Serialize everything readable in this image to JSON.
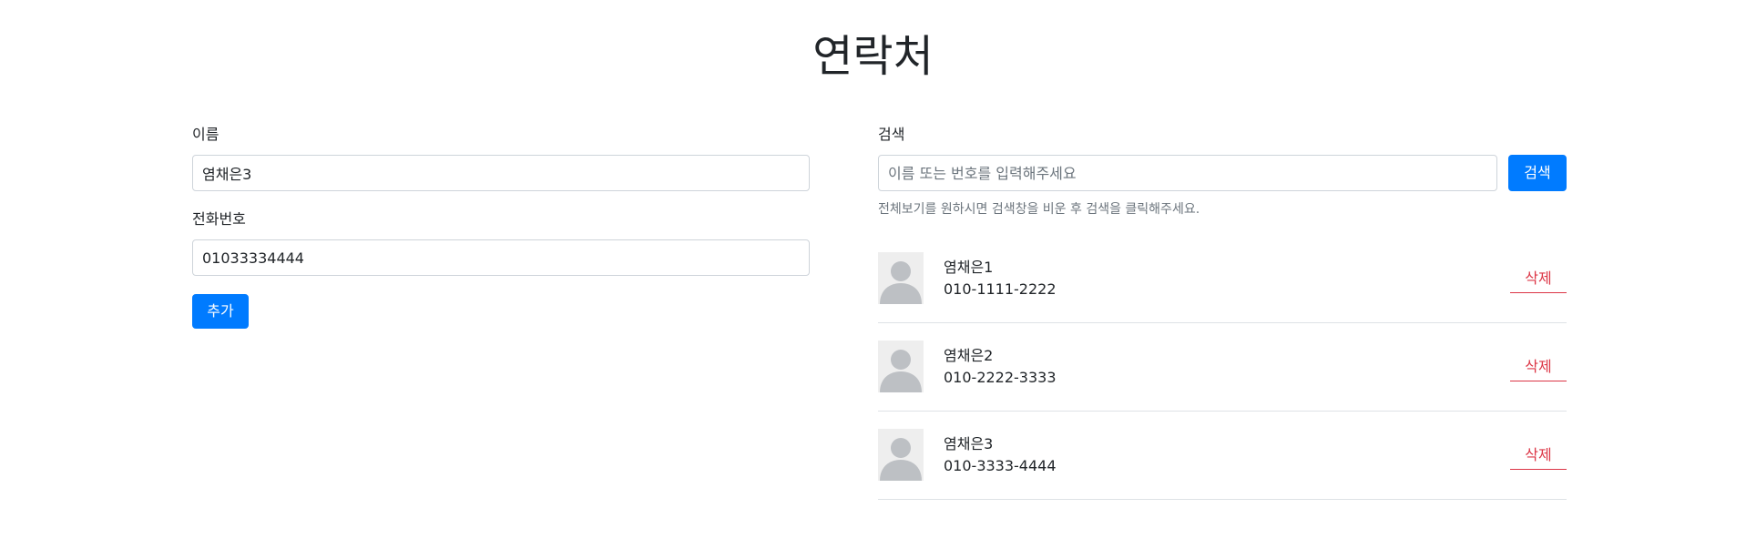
{
  "header": {
    "title": "연락처"
  },
  "add_form": {
    "name_label": "이름",
    "name_value": "염채은3",
    "phone_label": "전화번호",
    "phone_value": "01033334444",
    "add_label": "추가"
  },
  "search": {
    "label": "검색",
    "placeholder": "이름 또는 번호를 입력해주세요",
    "button_label": "검색",
    "help_text": "전체보기를 원하시면 검색창을 비운 후 검색을 클릭해주세요."
  },
  "contacts": [
    {
      "name": "염채은1",
      "phone": "010-1111-2222",
      "delete_label": "삭제"
    },
    {
      "name": "염채은2",
      "phone": "010-2222-3333",
      "delete_label": "삭제"
    },
    {
      "name": "염채은3",
      "phone": "010-3333-4444",
      "delete_label": "삭제"
    }
  ],
  "colors": {
    "primary": "#007bff",
    "danger": "#dc3545",
    "muted": "#6c757d",
    "avatar_bg": "#eeeeee",
    "avatar_fg": "#bdc0c4"
  },
  "icons": {
    "avatar": "user-silhouette-icon"
  }
}
